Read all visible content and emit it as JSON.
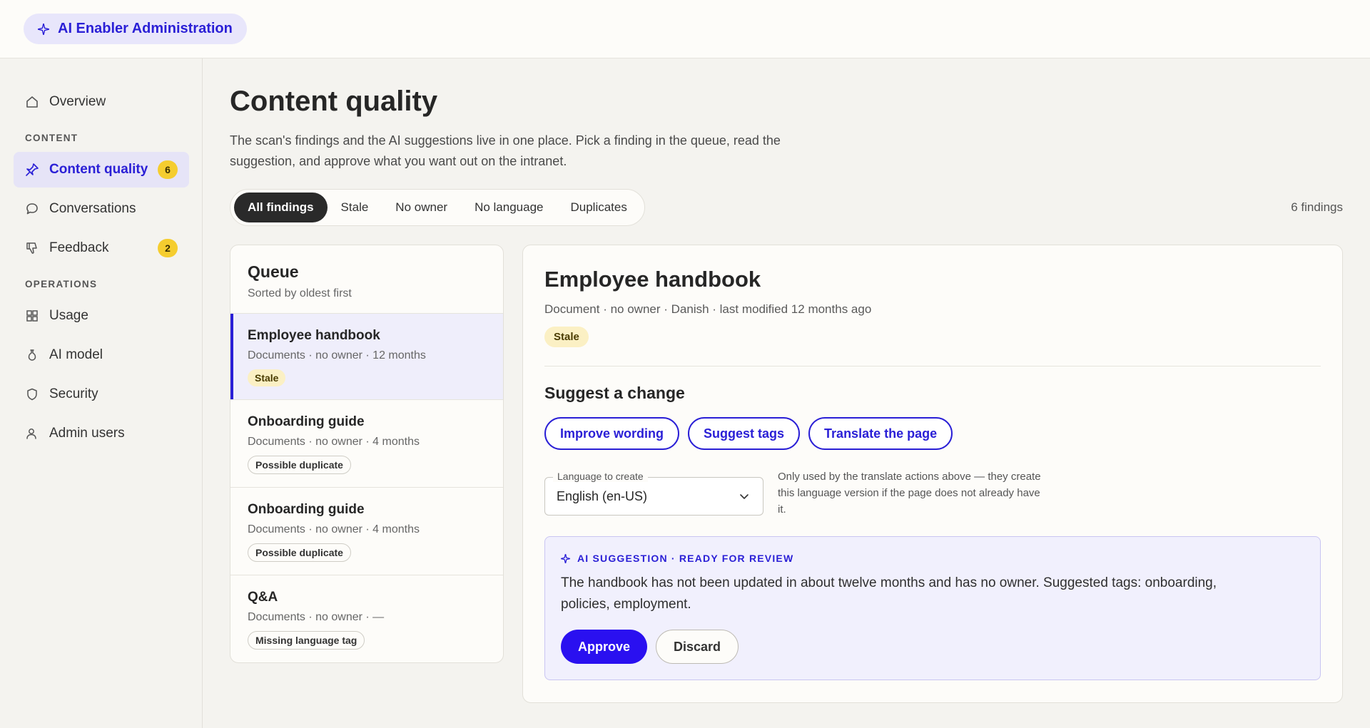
{
  "app": {
    "title": "AI Enabler Administration",
    "brand_icon": "sparkle-icon"
  },
  "sidebar": {
    "items": [
      {
        "label": "Overview",
        "icon": "home-icon"
      },
      {
        "section": "CONTENT"
      },
      {
        "label": "Content quality",
        "icon": "pin-icon",
        "badge": "6",
        "active": true
      },
      {
        "label": "Conversations",
        "icon": "chat-bubble-icon"
      },
      {
        "label": "Feedback",
        "icon": "thumbs-down-icon",
        "badge": "2"
      },
      {
        "section": "OPERATIONS"
      },
      {
        "label": "Usage",
        "icon": "grid-icon"
      },
      {
        "label": "AI model",
        "icon": "flask-icon"
      },
      {
        "label": "Security",
        "icon": "shield-icon"
      },
      {
        "label": "Admin users",
        "icon": "user-icon"
      }
    ],
    "overview": "Overview",
    "content_section": "CONTENT",
    "content_quality": "Content quality",
    "content_quality_badge": "6",
    "conversations": "Conversations",
    "feedback": "Feedback",
    "feedback_badge": "2",
    "operations_section": "OPERATIONS",
    "usage": "Usage",
    "ai_model": "AI model",
    "security": "Security",
    "admin_users": "Admin users"
  },
  "page": {
    "title": "Content quality",
    "description": "The scan's findings and the AI suggestions live in one place. Pick a finding in the queue, read the suggestion, and approve what you want out on the intranet.",
    "filters": [
      "All findings",
      "Stale",
      "No owner",
      "No language",
      "Duplicates"
    ],
    "active_filter": "All findings",
    "count": "6 findings"
  },
  "queue": {
    "title": "Queue",
    "subtitle": "Sorted by oldest first",
    "items": [
      {
        "name": "Employee handbook",
        "meta": "Documents · no owner · 12 months",
        "tag": "Stale"
      },
      {
        "name": "Onboarding guide",
        "meta": "Documents · no owner · 4 months",
        "tag": "Possible duplicate"
      },
      {
        "name": "Onboarding guide",
        "meta": "Documents · no owner · 4 months",
        "tag": "Possible duplicate"
      },
      {
        "name": "Q&A",
        "meta": "Documents · no owner · —",
        "tag": "Missing language tag"
      }
    ]
  },
  "detail": {
    "title": "Employee handbook",
    "meta": "Document · no owner · Danish · last modified 12 months ago",
    "tag": "Stale",
    "suggest_title": "Suggest a change",
    "actions": [
      "Improve wording",
      "Suggest tags",
      "Translate the page"
    ],
    "language_label": "Language to create",
    "language_value": "English (en-US)",
    "language_hint": "Only used by the translate actions above — they create this language version if the page does not already have it.",
    "ai_label": "AI SUGGESTION · READY FOR REVIEW",
    "ai_text": "The handbook has not been updated in about twelve months and has no owner. Suggested tags: onboarding, policies, employment.",
    "approve": "Approve",
    "discard": "Discard"
  },
  "colors": {
    "accent": "#2a1fd6",
    "badge": "#f5cd2f",
    "stale_tag": "#fbf0c4",
    "primary_button": "#2a10f0"
  }
}
